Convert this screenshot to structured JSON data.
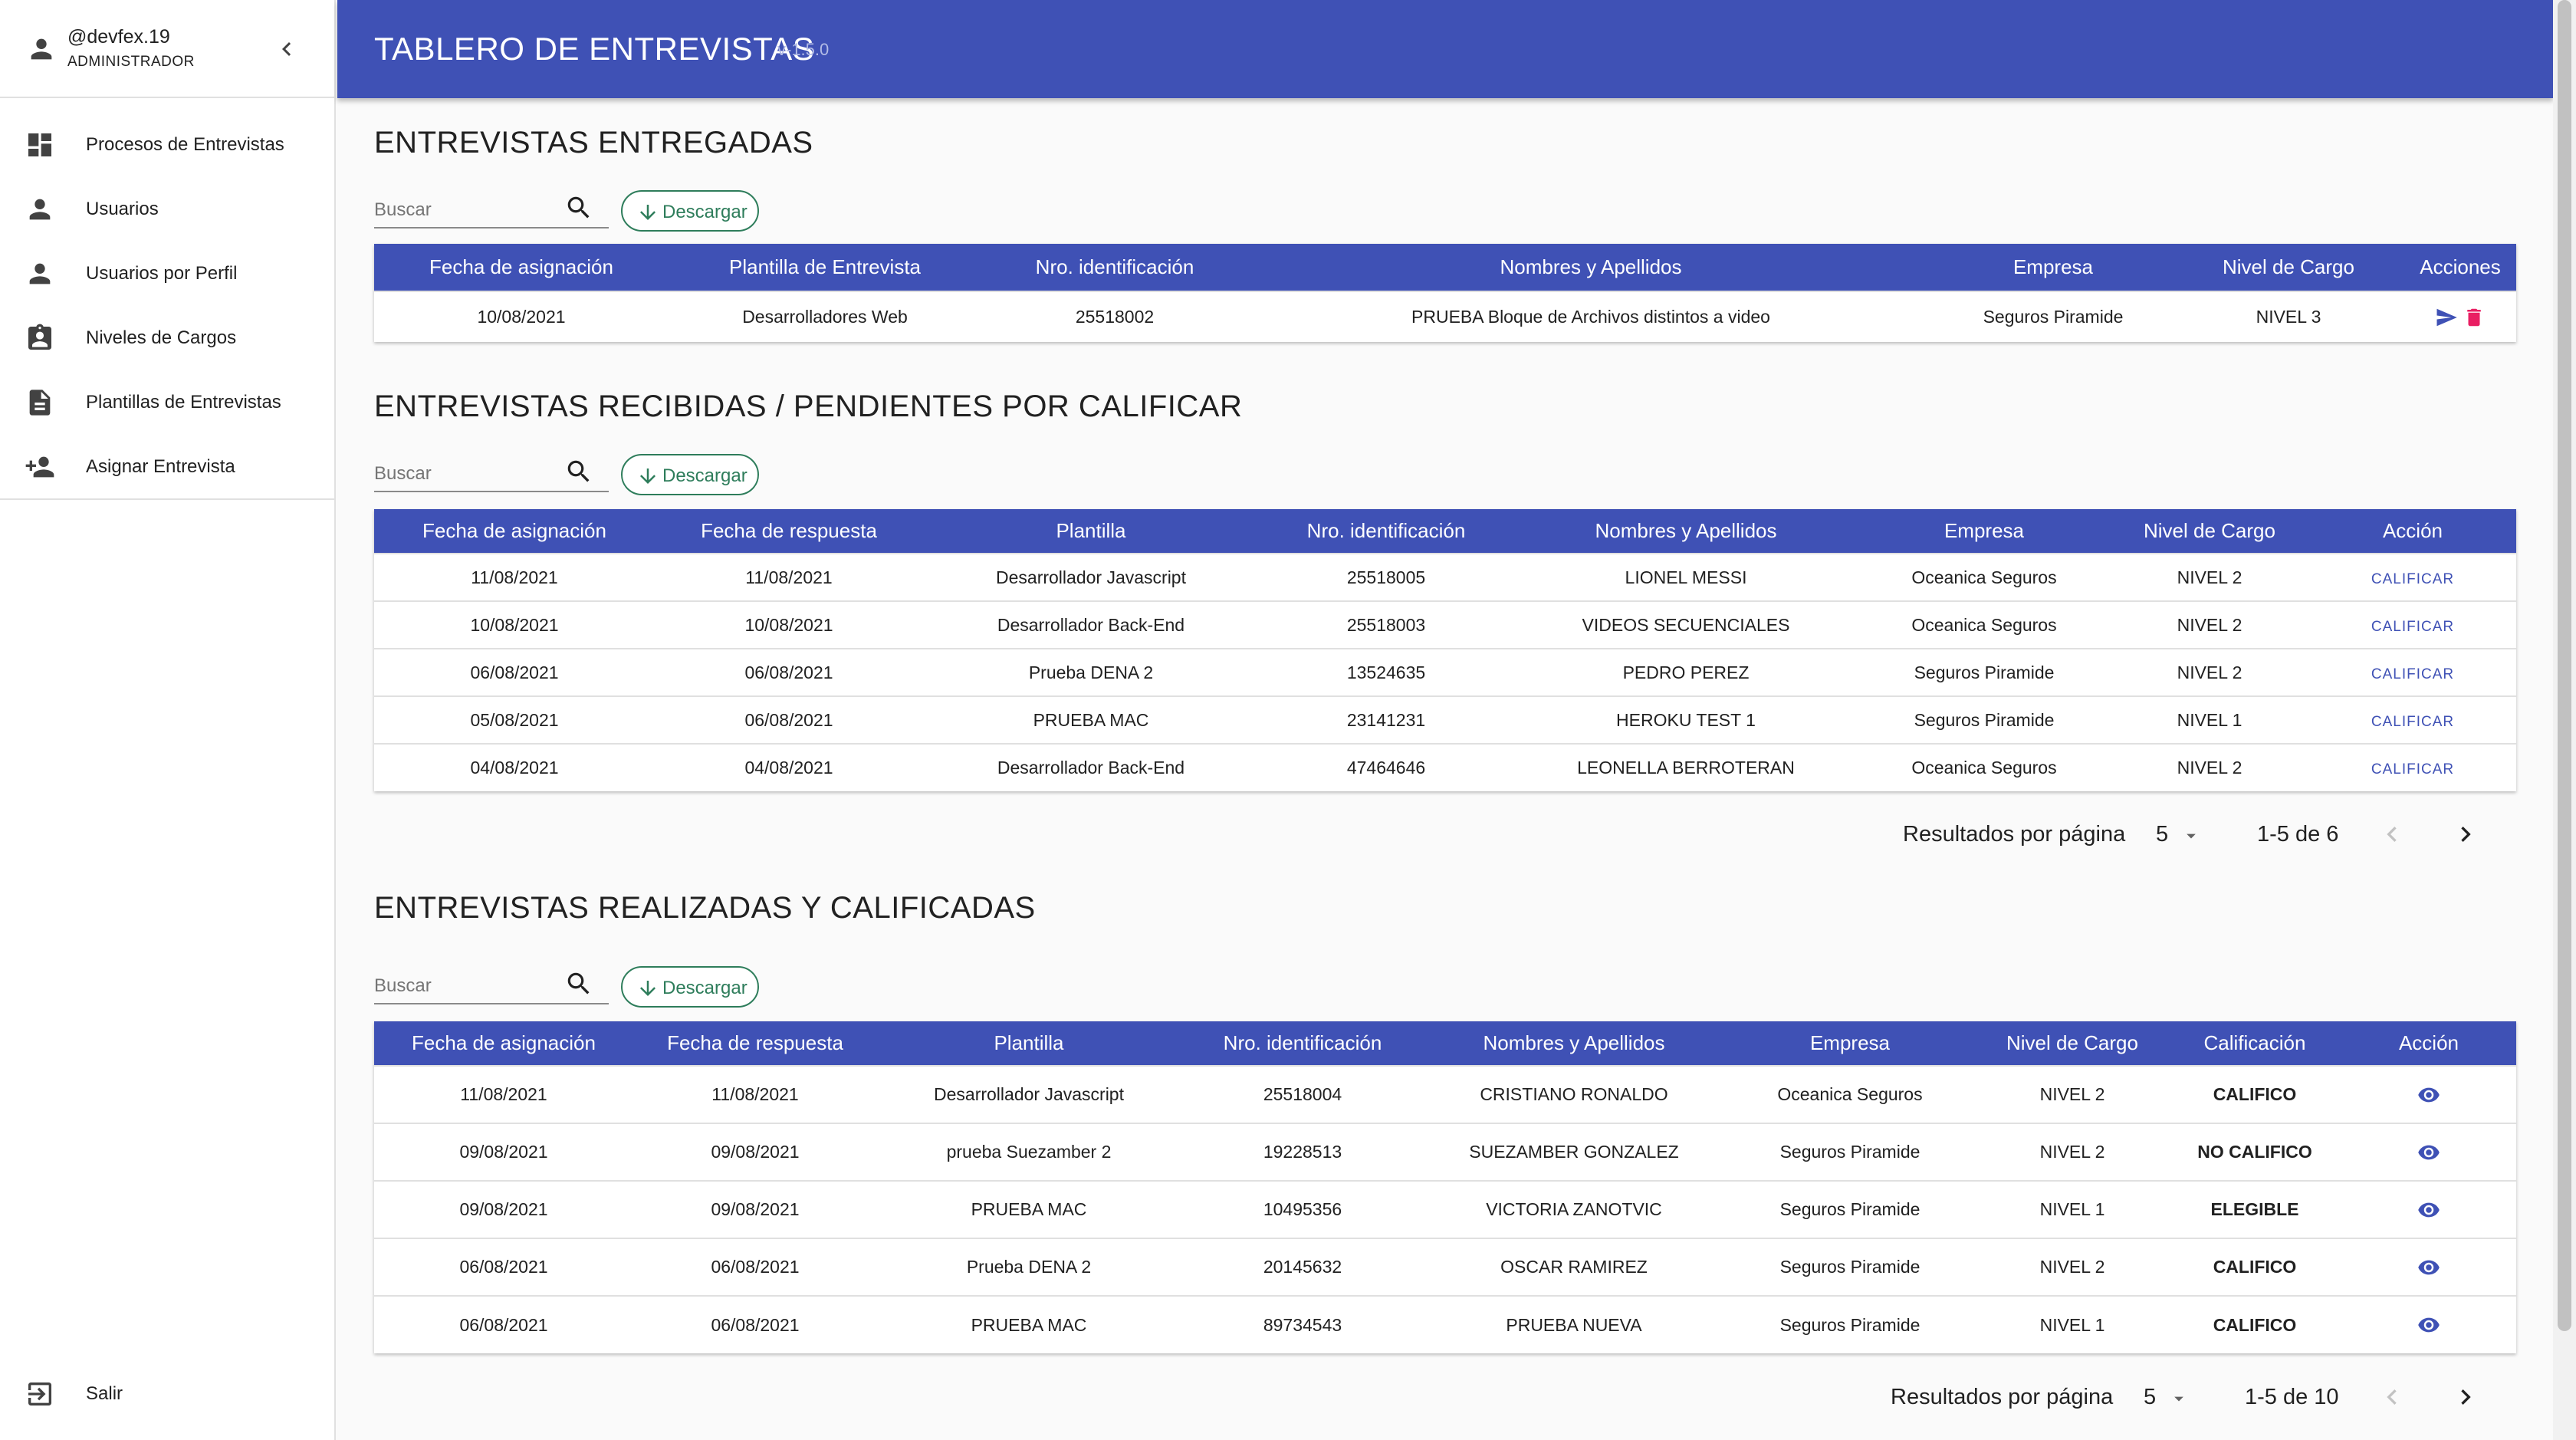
{
  "sidebar": {
    "user_name": "@devfex.19",
    "user_role": "ADMINISTRADOR",
    "items": [
      {
        "label": "Procesos de Entrevistas",
        "icon": "dashboard-icon"
      },
      {
        "label": "Usuarios",
        "icon": "person-icon"
      },
      {
        "label": "Usuarios por Perfil",
        "icon": "person-icon"
      },
      {
        "label": "Niveles de Cargos",
        "icon": "assignment-ind-icon"
      },
      {
        "label": "Plantillas de Entrevistas",
        "icon": "description-icon"
      },
      {
        "label": "Asignar Entrevista",
        "icon": "person-add-icon"
      }
    ],
    "logout_label": "Salir"
  },
  "header": {
    "title": "TABLERO DE ENTREVISTAS",
    "version": "v-1.5.0"
  },
  "colors": {
    "primary": "#3f51b5",
    "download": "#2e7d5b",
    "delete": "#e91e63"
  },
  "entregadas": {
    "title": "ENTREVISTAS ENTREGADAS",
    "search_placeholder": "Buscar",
    "download_label": "Descargar",
    "columns": [
      "Fecha de asignación",
      "Plantilla de Entrevista",
      "Nro. identificación",
      "Nombres y Apellidos",
      "Empresa",
      "Nivel de Cargo",
      "Acciones"
    ],
    "rows": [
      [
        "10/08/2021",
        "Desarrolladores Web",
        "25518002",
        "PRUEBA Bloque de Archivos distintos a video",
        "Seguros Piramide",
        "NIVEL 3"
      ]
    ]
  },
  "recibidas": {
    "title": "ENTREVISTAS RECIBIDAS / PENDIENTES POR CALIFICAR",
    "search_placeholder": "Buscar",
    "download_label": "Descargar",
    "columns": [
      "Fecha de asignación",
      "Fecha de respuesta",
      "Plantilla",
      "Nro. identificación",
      "Nombres y Apellidos",
      "Empresa",
      "Nivel de Cargo",
      "Acción"
    ],
    "action_label": "CALIFICAR",
    "rows": [
      [
        "11/08/2021",
        "11/08/2021",
        "Desarrollador Javascript",
        "25518005",
        "LIONEL MESSI",
        "Oceanica Seguros",
        "NIVEL 2"
      ],
      [
        "10/08/2021",
        "10/08/2021",
        "Desarrollador Back-End",
        "25518003",
        "VIDEOS SECUENCIALES",
        "Oceanica Seguros",
        "NIVEL 2"
      ],
      [
        "06/08/2021",
        "06/08/2021",
        "Prueba DENA 2",
        "13524635",
        "PEDRO PEREZ",
        "Seguros Piramide",
        "NIVEL 2"
      ],
      [
        "05/08/2021",
        "06/08/2021",
        "PRUEBA MAC",
        "23141231",
        "HEROKU TEST 1",
        "Seguros Piramide",
        "NIVEL 1"
      ],
      [
        "04/08/2021",
        "04/08/2021",
        "Desarrollador Back-End",
        "47464646",
        "LEONELLA BERROTERAN",
        "Oceanica Seguros",
        "NIVEL 2"
      ]
    ],
    "pager": {
      "label": "Resultados por página",
      "size": "5",
      "range": "1-5 de 6"
    }
  },
  "realizadas": {
    "title": "ENTREVISTAS REALIZADAS Y CALIFICADAS",
    "search_placeholder": "Buscar",
    "download_label": "Descargar",
    "columns": [
      "Fecha de asignación",
      "Fecha de respuesta",
      "Plantilla",
      "Nro. identificación",
      "Nombres y Apellidos",
      "Empresa",
      "Nivel de Cargo",
      "Calificación",
      "Acción"
    ],
    "rows": [
      [
        "11/08/2021",
        "11/08/2021",
        "Desarrollador Javascript",
        "25518004",
        "CRISTIANO RONALDO",
        "Oceanica Seguros",
        "NIVEL 2",
        "CALIFICO"
      ],
      [
        "09/08/2021",
        "09/08/2021",
        "prueba Suezamber 2",
        "19228513",
        "SUEZAMBER GONZALEZ",
        "Seguros Piramide",
        "NIVEL 2",
        "NO CALIFICO"
      ],
      [
        "09/08/2021",
        "09/08/2021",
        "PRUEBA MAC",
        "10495356",
        "VICTORIA ZANOTVIC",
        "Seguros Piramide",
        "NIVEL 1",
        "ELEGIBLE"
      ],
      [
        "06/08/2021",
        "06/08/2021",
        "Prueba DENA 2",
        "20145632",
        "OSCAR RAMIREZ",
        "Seguros Piramide",
        "NIVEL 2",
        "CALIFICO"
      ],
      [
        "06/08/2021",
        "06/08/2021",
        "PRUEBA MAC",
        "89734543",
        "PRUEBA NUEVA",
        "Seguros Piramide",
        "NIVEL 1",
        "CALIFICO"
      ]
    ],
    "pager": {
      "label": "Resultados por página",
      "size": "5",
      "range": "1-5 de 10"
    }
  }
}
